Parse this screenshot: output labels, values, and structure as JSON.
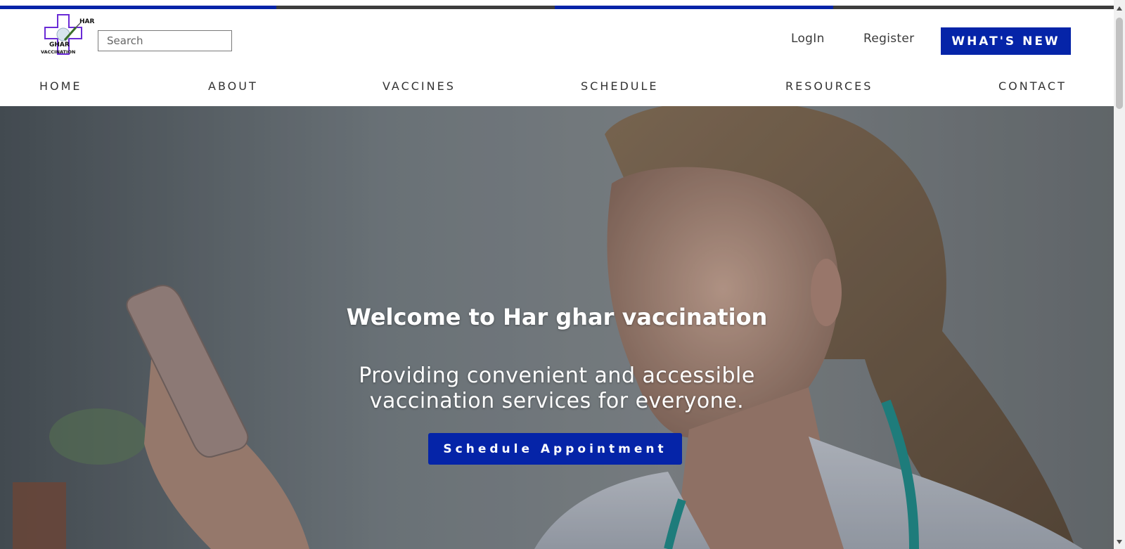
{
  "brand": {
    "logo_text_top": "HAR",
    "logo_text_mid": "GHAR",
    "logo_text_bottom": "VACCINATION",
    "accent_color": "#0524a8"
  },
  "header": {
    "search_placeholder": "Search",
    "login_label": "LogIn",
    "register_label": "Register",
    "whats_new_label": "WHAT'S NEW"
  },
  "nav": {
    "items": [
      "HOME",
      "ABOUT",
      "VACCINES",
      "SCHEDULE",
      "RESOURCES",
      "CONTACT"
    ]
  },
  "hero": {
    "title": "Welcome to Har ghar vaccination",
    "subtitle_line1": "Providing convenient and accessible",
    "subtitle_line2": "vaccination services for everyone.",
    "cta_label": "Schedule Appointment",
    "image_subject": "doctor-with-phone-photo"
  },
  "icons": {
    "logo": "medical-cross-syringe-logo",
    "scroll_up": "chevron-up-icon",
    "scroll_down": "chevron-down-icon"
  }
}
